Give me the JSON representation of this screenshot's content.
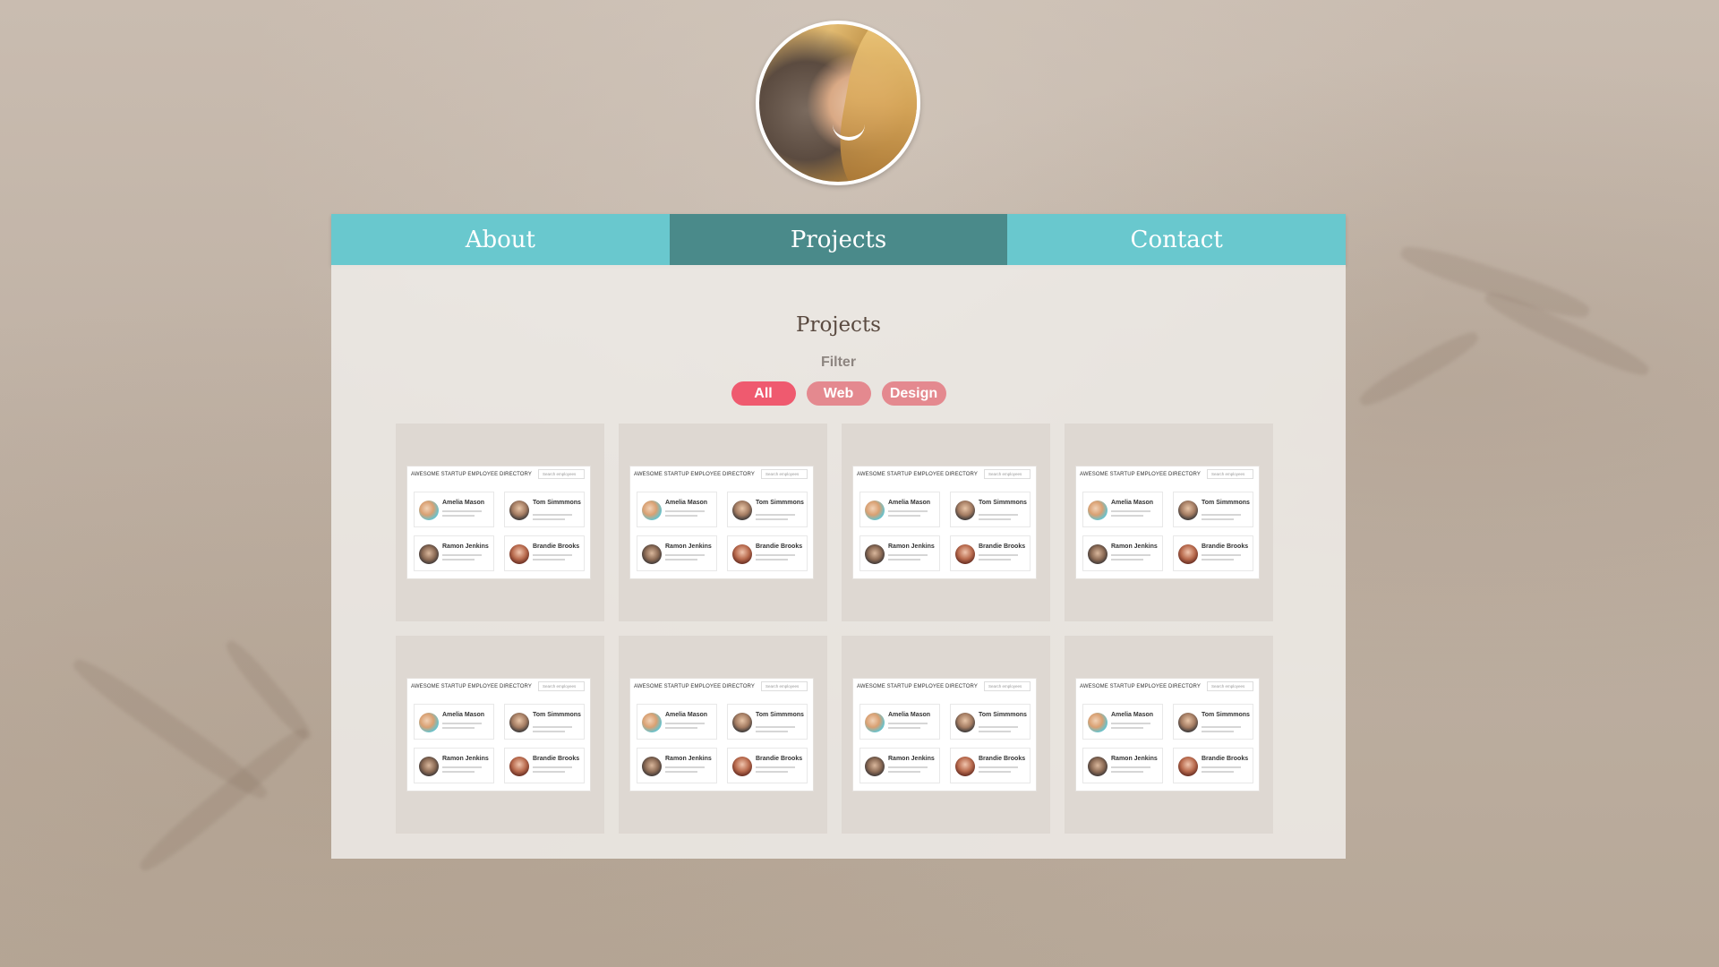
{
  "nav": {
    "tabs": [
      {
        "label": "About",
        "active": false
      },
      {
        "label": "Projects",
        "active": true
      },
      {
        "label": "Contact",
        "active": false
      }
    ]
  },
  "panel": {
    "title": "Projects",
    "filter_label": "Filter",
    "filters": [
      {
        "label": "All",
        "active": true
      },
      {
        "label": "Web",
        "active": false
      },
      {
        "label": "Design",
        "active": false
      }
    ]
  },
  "project_thumb": {
    "heading": "AWESOME STARTUP EMPLOYEE DIRECTORY",
    "search_placeholder": "Search employees",
    "employees": [
      {
        "name": "Amelia Mason"
      },
      {
        "name": "Tom Simmmons"
      },
      {
        "name": "Ramon Jenkins"
      },
      {
        "name": "Brandie Brooks"
      }
    ]
  },
  "colors": {
    "nav_tab": "#69c8ce",
    "nav_tab_active": "#4a8a8a",
    "filter_active": "#ef5a6f",
    "filter_inactive": "#e4898f"
  }
}
